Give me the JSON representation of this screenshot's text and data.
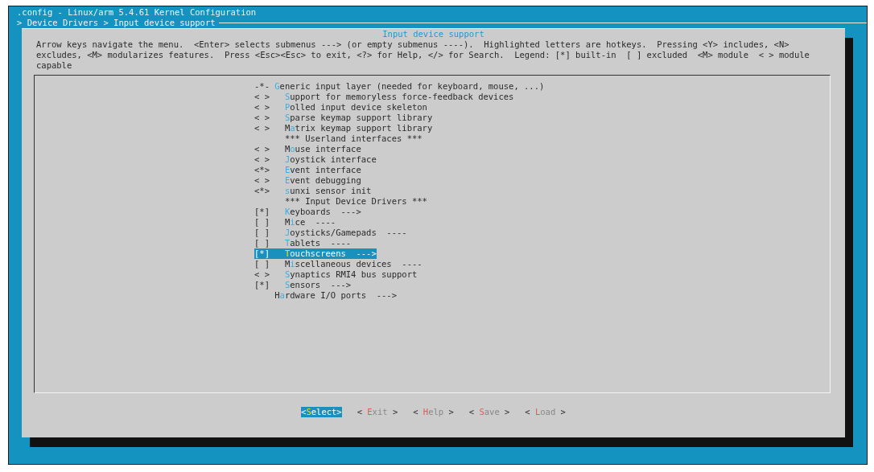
{
  "window": {
    "title": ".config - Linux/arm 5.4.61 Kernel Configuration"
  },
  "breadcrumb": "> Device Drivers > Input device support",
  "dialog": {
    "title": "Input device support",
    "help": "Arrow keys navigate the menu.  <Enter> selects submenus ---> (or empty submenus ----).  Highlighted letters are hotkeys.  Pressing <Y> includes, <N> excludes, <M> modularizes features.  Press <Esc><Esc> to exit, <?> for Help, </> for Search.  Legend: [*] built-in  [ ] excluded  <M> module  < > module capable",
    "items": [
      {
        "kind": "option",
        "state": "-*-",
        "hotkey": "G",
        "rest": "eneric input layer (needed for keyboard, mouse, ...)",
        "selected": false,
        "children": [
          {
            "kind": "option",
            "state": "< >",
            "hotkey": "S",
            "rest": "upport for memoryless force-feedback devices",
            "selected": false
          },
          {
            "kind": "option",
            "state": "< >",
            "hotkey": "P",
            "rest": "olled input device skeleton",
            "selected": false
          },
          {
            "kind": "option",
            "state": "< >",
            "hotkey": "S",
            "rest": "parse keymap support library",
            "selected": false
          },
          {
            "kind": "option",
            "state": "< >",
            "pre": "M",
            "hotkey": "a",
            "rest": "trix keymap support library",
            "selected": false
          },
          {
            "kind": "comment",
            "text": "*** Userland interfaces ***"
          },
          {
            "kind": "option",
            "state": "< >",
            "pre": "M",
            "hotkey": "o",
            "rest": "use interface",
            "selected": false
          },
          {
            "kind": "option",
            "state": "< >",
            "hotkey": "J",
            "rest": "oystick interface",
            "selected": false
          },
          {
            "kind": "option",
            "state": "<*>",
            "hotkey": "E",
            "rest": "vent interface",
            "selected": false
          },
          {
            "kind": "option",
            "state": "< >",
            "hotkey": "E",
            "rest": "vent debugging",
            "selected": false
          },
          {
            "kind": "option",
            "state": "<*>",
            "hotkey": "s",
            "rest": "unxi sensor init",
            "selected": false
          },
          {
            "kind": "comment",
            "text": "*** Input Device Drivers ***"
          },
          {
            "kind": "option",
            "state": "[*]",
            "hotkey": "K",
            "rest": "eyboards  --->",
            "selected": false
          },
          {
            "kind": "option",
            "state": "[ ]",
            "pre": "M",
            "hotkey": "i",
            "rest": "ce  ----",
            "selected": false
          },
          {
            "kind": "option",
            "state": "[ ]",
            "hotkey": "J",
            "rest": "oysticks/Gamepads  ----",
            "selected": false
          },
          {
            "kind": "option",
            "state": "[ ]",
            "hotkey": "T",
            "rest": "ablets  ----",
            "selected": false
          },
          {
            "kind": "option",
            "state": "[*]",
            "hotkey": "T",
            "rest": "ouchscreens  --->",
            "selected": true
          },
          {
            "kind": "option",
            "state": "[ ]",
            "pre": "M",
            "hotkey": "i",
            "rest": "scellaneous devices  ----",
            "selected": false
          },
          {
            "kind": "option",
            "state": "< >",
            "hotkey": "S",
            "rest": "ynaptics RMI4 bus support",
            "selected": false
          },
          {
            "kind": "option",
            "state": "[*]",
            "hotkey": "S",
            "rest": "ensors  --->",
            "selected": false
          }
        ]
      },
      {
        "kind": "option",
        "pre": "H",
        "hotkey": "a",
        "rest": "rdware I/O ports  --->",
        "selected": false
      }
    ],
    "buttons": [
      {
        "open": "<",
        "hotkey": "S",
        "rest": "elect",
        "close": ">",
        "selected": true
      },
      {
        "open": "< ",
        "hotkey": "E",
        "rest": "xit",
        "close": " >",
        "selected": false
      },
      {
        "open": "< ",
        "hotkey": "H",
        "rest": "elp",
        "close": " >",
        "selected": false
      },
      {
        "open": "< ",
        "hotkey": "S",
        "rest": "ave",
        "close": " >",
        "selected": false
      },
      {
        "open": "< ",
        "hotkey": "L",
        "rest": "oad",
        "close": " >",
        "selected": false
      }
    ]
  }
}
